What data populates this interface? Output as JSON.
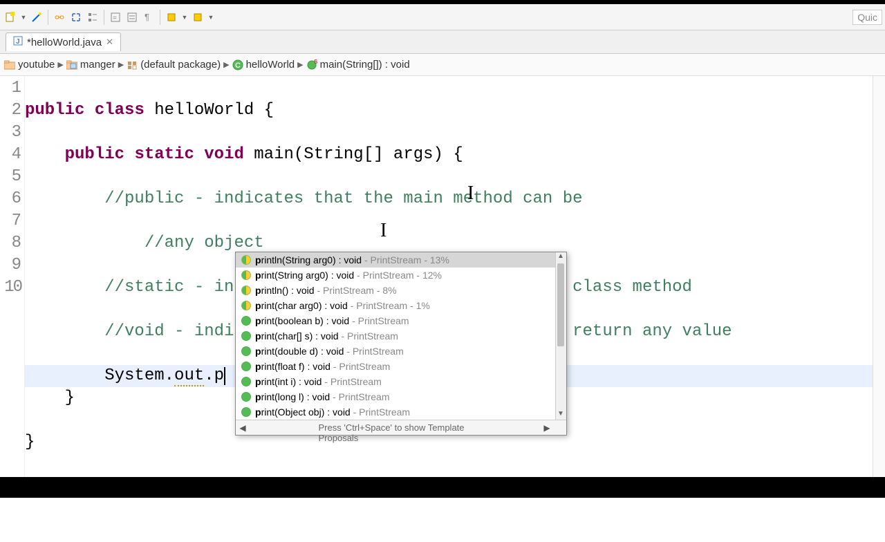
{
  "toolbar": {
    "quick": "Quic"
  },
  "tab": {
    "title": "*helloWorld.java"
  },
  "breadcrumb": {
    "items": [
      {
        "icon": "project",
        "label": "youtube"
      },
      {
        "icon": "folder",
        "label": "manger"
      },
      {
        "icon": "package",
        "label": "(default package)"
      },
      {
        "icon": "class",
        "label": "helloWorld"
      },
      {
        "icon": "method",
        "label": "main(String[]) : void"
      }
    ]
  },
  "gutter": [
    "1",
    "2",
    "3",
    "4",
    "5",
    "6",
    "7",
    "8",
    "9",
    "10"
  ],
  "code": {
    "l1_kw1": "public",
    "l1_kw2": "class",
    "l1_name": " helloWorld {",
    "l2_kw1": "public",
    "l2_kw2": "static",
    "l2_kw3": "void",
    "l2_rest": " main(String[] args) {",
    "l3": "        //public - indicates that the main method can be",
    "l4": "            //any object",
    "l5": "        //static - indicates that the main method is a class method",
    "l6": "        //void - indicates the the main method doesn't return any value",
    "l7a": "        System.",
    "l7b": "out",
    "l7c": ".p",
    "l8": "    }",
    "l9": "}"
  },
  "autocomplete": {
    "items": [
      {
        "bold": "p",
        "sig": "rintln(String arg0) : void",
        "meta": " - PrintStream - 13%",
        "half": true,
        "selected": true
      },
      {
        "bold": "p",
        "sig": "rint(String arg0) : void",
        "meta": " - PrintStream - 12%",
        "half": true
      },
      {
        "bold": "p",
        "sig": "rintln() : void",
        "meta": " - PrintStream - 8%",
        "half": true
      },
      {
        "bold": "p",
        "sig": "rint(char arg0) : void",
        "meta": " - PrintStream - 1%",
        "half": true
      },
      {
        "bold": "p",
        "sig": "rint(boolean b) : void",
        "meta": " - PrintStream"
      },
      {
        "bold": "p",
        "sig": "rint(char[] s) : void",
        "meta": " - PrintStream"
      },
      {
        "bold": "p",
        "sig": "rint(double d) : void",
        "meta": " - PrintStream"
      },
      {
        "bold": "p",
        "sig": "rint(float f) : void",
        "meta": " - PrintStream"
      },
      {
        "bold": "p",
        "sig": "rint(int i) : void",
        "meta": " - PrintStream"
      },
      {
        "bold": "p",
        "sig": "rint(long l) : void",
        "meta": " - PrintStream"
      },
      {
        "bold": "p",
        "sig": "rint(Object obj) : void",
        "meta": " - PrintStream"
      }
    ],
    "hint": "Press 'Ctrl+Space' to show Template Proposals"
  }
}
